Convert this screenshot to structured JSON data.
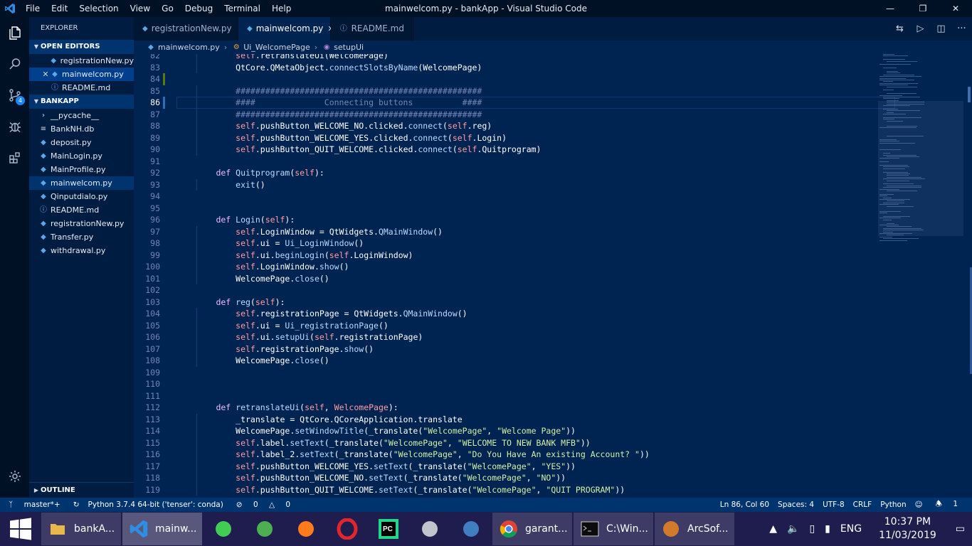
{
  "window": {
    "title": "mainwelcom.py - bankApp - Visual Studio Code",
    "menu": [
      "File",
      "Edit",
      "Selection",
      "View",
      "Go",
      "Debug",
      "Terminal",
      "Help"
    ],
    "controls": [
      "—",
      "❐",
      "✕"
    ]
  },
  "activity": {
    "scm_badge": "4"
  },
  "sidebar": {
    "title": "EXPLORER",
    "open_editors_title": "OPEN EDITORS",
    "open_editors": [
      {
        "name": "registrationNew.py",
        "icon": "py"
      },
      {
        "name": "mainwelcom.py",
        "icon": "py",
        "close": "✕"
      },
      {
        "name": "README.md",
        "icon": "info"
      }
    ],
    "project_title": "BANKAPP",
    "files": [
      {
        "name": "__pycache__",
        "icon": "folder"
      },
      {
        "name": "BankNH.db",
        "icon": "db"
      },
      {
        "name": "deposit.py",
        "icon": "py"
      },
      {
        "name": "MainLogin.py",
        "icon": "py"
      },
      {
        "name": "MainProfile.py",
        "icon": "py"
      },
      {
        "name": "mainwelcom.py",
        "icon": "py"
      },
      {
        "name": "Qinputdialo.py",
        "icon": "py"
      },
      {
        "name": "README.md",
        "icon": "info"
      },
      {
        "name": "registrationNew.py",
        "icon": "py"
      },
      {
        "name": "Transfer.py",
        "icon": "py"
      },
      {
        "name": "withdrawal.py",
        "icon": "py"
      }
    ],
    "outline_title": "OUTLINE"
  },
  "tabs": [
    {
      "label": "registrationNew.py",
      "icon": "py"
    },
    {
      "label": "mainwelcom.py",
      "icon": "py",
      "close": "✕"
    },
    {
      "label": "README.md",
      "icon": "info"
    }
  ],
  "breadcrumb": [
    "mainwelcom.py",
    "Ui_WelcomePage",
    "setupUi"
  ],
  "editor": {
    "current_line": "86",
    "lines": [
      {
        "n": "82",
        "indent": 2,
        "t": [
          [
            "self",
            "self"
          ],
          [
            "plain",
            ".retranslateUi(WelcomePage)"
          ]
        ]
      },
      {
        "n": "83",
        "indent": 2,
        "t": [
          [
            "plain",
            "QtCore.QMetaObject."
          ],
          [
            "fn",
            "connectSlotsByName"
          ],
          [
            "plain",
            "(WelcomePage)"
          ]
        ]
      },
      {
        "n": "84",
        "indent": 1,
        "t": []
      },
      {
        "n": "85",
        "indent": 2,
        "t": [
          [
            "cm",
            "##################################################"
          ]
        ]
      },
      {
        "n": "86",
        "indent": 2,
        "t": [
          [
            "cm",
            "####              Connecting buttons          ####"
          ]
        ]
      },
      {
        "n": "87",
        "indent": 2,
        "t": [
          [
            "cm",
            "##################################################"
          ]
        ]
      },
      {
        "n": "88",
        "indent": 2,
        "t": [
          [
            "self",
            "self"
          ],
          [
            "plain",
            ".pushButton_WELCOME_NO.clicked."
          ],
          [
            "fn",
            "connect"
          ],
          [
            "plain",
            "("
          ],
          [
            "self",
            "self"
          ],
          [
            "plain",
            ".reg)"
          ]
        ]
      },
      {
        "n": "89",
        "indent": 2,
        "t": [
          [
            "self",
            "self"
          ],
          [
            "plain",
            ".pushButton_WELCOME_YES.clicked."
          ],
          [
            "fn",
            "connect"
          ],
          [
            "plain",
            "("
          ],
          [
            "self",
            "self"
          ],
          [
            "plain",
            ".Login)"
          ]
        ]
      },
      {
        "n": "90",
        "indent": 2,
        "t": [
          [
            "self",
            "self"
          ],
          [
            "plain",
            ".pushButton_QUIT_WELCOME.clicked."
          ],
          [
            "fn",
            "connect"
          ],
          [
            "plain",
            "("
          ],
          [
            "self",
            "self"
          ],
          [
            "plain",
            ".Quitprogram)"
          ]
        ]
      },
      {
        "n": "91",
        "indent": 1,
        "t": []
      },
      {
        "n": "92",
        "indent": 1,
        "t": [
          [
            "kw",
            "def "
          ],
          [
            "fn",
            "Quitprogram"
          ],
          [
            "plain",
            "("
          ],
          [
            "self",
            "self"
          ],
          [
            "plain",
            "):"
          ]
        ]
      },
      {
        "n": "93",
        "indent": 2,
        "t": [
          [
            "fn",
            "exit"
          ],
          [
            "plain",
            "()"
          ]
        ]
      },
      {
        "n": "94",
        "indent": 1,
        "t": []
      },
      {
        "n": "95",
        "indent": 1,
        "t": []
      },
      {
        "n": "96",
        "indent": 1,
        "t": [
          [
            "kw",
            "def "
          ],
          [
            "fn",
            "Login"
          ],
          [
            "plain",
            "("
          ],
          [
            "self",
            "self"
          ],
          [
            "plain",
            "):"
          ]
        ]
      },
      {
        "n": "97",
        "indent": 2,
        "t": [
          [
            "self",
            "self"
          ],
          [
            "plain",
            ".LoginWindow = QtWidgets."
          ],
          [
            "fn",
            "QMainWindow"
          ],
          [
            "plain",
            "()"
          ]
        ]
      },
      {
        "n": "98",
        "indent": 2,
        "t": [
          [
            "self",
            "self"
          ],
          [
            "plain",
            ".ui = "
          ],
          [
            "fn",
            "Ui_LoginWindow"
          ],
          [
            "plain",
            "()"
          ]
        ]
      },
      {
        "n": "99",
        "indent": 2,
        "t": [
          [
            "self",
            "self"
          ],
          [
            "plain",
            ".ui."
          ],
          [
            "fn",
            "beginLogin"
          ],
          [
            "plain",
            "("
          ],
          [
            "self",
            "self"
          ],
          [
            "plain",
            ".LoginWindow)"
          ]
        ]
      },
      {
        "n": "100",
        "indent": 2,
        "t": [
          [
            "self",
            "self"
          ],
          [
            "plain",
            ".LoginWindow."
          ],
          [
            "fn",
            "show"
          ],
          [
            "plain",
            "()"
          ]
        ]
      },
      {
        "n": "101",
        "indent": 2,
        "t": [
          [
            "plain",
            "WelcomePage."
          ],
          [
            "fn",
            "close"
          ],
          [
            "plain",
            "()"
          ]
        ]
      },
      {
        "n": "102",
        "indent": 1,
        "t": []
      },
      {
        "n": "103",
        "indent": 1,
        "t": [
          [
            "kw",
            "def "
          ],
          [
            "fn",
            "reg"
          ],
          [
            "plain",
            "("
          ],
          [
            "self",
            "self"
          ],
          [
            "plain",
            "):"
          ]
        ]
      },
      {
        "n": "104",
        "indent": 2,
        "t": [
          [
            "self",
            "self"
          ],
          [
            "plain",
            ".registrationPage = QtWidgets."
          ],
          [
            "fn",
            "QMainWindow"
          ],
          [
            "plain",
            "()"
          ]
        ]
      },
      {
        "n": "105",
        "indent": 2,
        "t": [
          [
            "self",
            "self"
          ],
          [
            "plain",
            ".ui = "
          ],
          [
            "fn",
            "Ui_registrationPage"
          ],
          [
            "plain",
            "()"
          ]
        ]
      },
      {
        "n": "106",
        "indent": 2,
        "t": [
          [
            "self",
            "self"
          ],
          [
            "plain",
            ".ui."
          ],
          [
            "fn",
            "setupUi"
          ],
          [
            "plain",
            "("
          ],
          [
            "self",
            "self"
          ],
          [
            "plain",
            ".registrationPage)"
          ]
        ]
      },
      {
        "n": "107",
        "indent": 2,
        "t": [
          [
            "self",
            "self"
          ],
          [
            "plain",
            ".registrationPage."
          ],
          [
            "fn",
            "show"
          ],
          [
            "plain",
            "()"
          ]
        ]
      },
      {
        "n": "108",
        "indent": 2,
        "t": [
          [
            "plain",
            "WelcomePage."
          ],
          [
            "fn",
            "close"
          ],
          [
            "plain",
            "()"
          ]
        ]
      },
      {
        "n": "109",
        "indent": 1,
        "t": []
      },
      {
        "n": "110",
        "indent": 1,
        "t": []
      },
      {
        "n": "111",
        "indent": 1,
        "t": []
      },
      {
        "n": "112",
        "indent": 1,
        "t": [
          [
            "kw",
            "def "
          ],
          [
            "fn",
            "retranslateUi"
          ],
          [
            "plain",
            "("
          ],
          [
            "self",
            "self"
          ],
          [
            "plain",
            ", "
          ],
          [
            "self",
            "WelcomePage"
          ],
          [
            "plain",
            "):"
          ]
        ]
      },
      {
        "n": "113",
        "indent": 2,
        "t": [
          [
            "plain",
            "_translate = QtCore.QCoreApplication.translate"
          ]
        ]
      },
      {
        "n": "114",
        "indent": 2,
        "t": [
          [
            "plain",
            "WelcomePage."
          ],
          [
            "fn",
            "setWindowTitle"
          ],
          [
            "plain",
            "(_translate("
          ],
          [
            "str",
            "\"WelcomePage\""
          ],
          [
            "plain",
            ", "
          ],
          [
            "str",
            "\"Welcome Page\""
          ],
          [
            "plain",
            "))"
          ]
        ]
      },
      {
        "n": "115",
        "indent": 2,
        "t": [
          [
            "self",
            "self"
          ],
          [
            "plain",
            ".label."
          ],
          [
            "fn",
            "setText"
          ],
          [
            "plain",
            "(_translate("
          ],
          [
            "str",
            "\"WelcomePage\""
          ],
          [
            "plain",
            ", "
          ],
          [
            "str",
            "\"WELCOME TO NEW BANK MFB\""
          ],
          [
            "plain",
            "))"
          ]
        ]
      },
      {
        "n": "116",
        "indent": 2,
        "t": [
          [
            "self",
            "self"
          ],
          [
            "plain",
            ".label_2."
          ],
          [
            "fn",
            "setText"
          ],
          [
            "plain",
            "(_translate("
          ],
          [
            "str",
            "\"WelcomePage\""
          ],
          [
            "plain",
            ", "
          ],
          [
            "str",
            "\"Do You Have An existing Account? \""
          ],
          [
            "plain",
            "))"
          ]
        ]
      },
      {
        "n": "117",
        "indent": 2,
        "t": [
          [
            "self",
            "self"
          ],
          [
            "plain",
            ".pushButton_WELCOME_YES."
          ],
          [
            "fn",
            "setText"
          ],
          [
            "plain",
            "(_translate("
          ],
          [
            "str",
            "\"WelcomePage\""
          ],
          [
            "plain",
            ", "
          ],
          [
            "str",
            "\"YES\""
          ],
          [
            "plain",
            "))"
          ]
        ]
      },
      {
        "n": "118",
        "indent": 2,
        "t": [
          [
            "self",
            "self"
          ],
          [
            "plain",
            ".pushButton_WELCOME_NO."
          ],
          [
            "fn",
            "setText"
          ],
          [
            "plain",
            "(_translate("
          ],
          [
            "str",
            "\"WelcomePage\""
          ],
          [
            "plain",
            ", "
          ],
          [
            "str",
            "\"NO\""
          ],
          [
            "plain",
            "))"
          ]
        ]
      },
      {
        "n": "119",
        "indent": 2,
        "t": [
          [
            "self",
            "self"
          ],
          [
            "plain",
            ".pushButton_QUIT_WELCOME."
          ],
          [
            "fn",
            "setText"
          ],
          [
            "plain",
            "(_translate("
          ],
          [
            "str",
            "\"WelcomePage\""
          ],
          [
            "plain",
            ", "
          ],
          [
            "str",
            "\"QUIT PROGRAM\""
          ],
          [
            "plain",
            "))"
          ]
        ]
      }
    ]
  },
  "statusbar": {
    "branch": "master*+",
    "interpreter": "Python 3.7.4 64-bit ('tenser': conda)",
    "errors": "0",
    "warnings": "0",
    "position": "Ln 86, Col 60",
    "spaces": "Spaces: 4",
    "encoding": "UTF-8",
    "eol": "CRLF",
    "language": "Python",
    "notifications": "1"
  },
  "taskbar": {
    "apps": [
      {
        "kind": "wide",
        "label": "bankA...",
        "icon": "folder-icon",
        "color": "#e8b84a"
      },
      {
        "kind": "wide",
        "label": "mainw...",
        "icon": "vscode-icon",
        "color": "#2f8de4",
        "active": true
      },
      {
        "kind": "icon",
        "label": "",
        "icon": "qt-icon",
        "color": "#41cd52"
      },
      {
        "kind": "icon",
        "label": "",
        "icon": "greenapp-icon",
        "color": "#4caf50"
      },
      {
        "kind": "icon",
        "label": "",
        "icon": "firefox-icon",
        "color": "#ff7a1a"
      },
      {
        "kind": "icon",
        "label": "",
        "icon": "opera-icon",
        "color": "#e2262c"
      },
      {
        "kind": "icon",
        "label": "",
        "icon": "pycharm-icon",
        "color": "#21d789"
      },
      {
        "kind": "icon",
        "label": "",
        "icon": "database-icon",
        "color": "#c0c4cc"
      },
      {
        "kind": "icon",
        "label": "",
        "icon": "mysql-icon",
        "color": "#3f7fbf"
      },
      {
        "kind": "wide",
        "label": "garant...",
        "icon": "chrome-icon",
        "color": "#e0b90f"
      },
      {
        "kind": "wide",
        "label": "C:\\Win...",
        "icon": "cmd-icon",
        "color": "#111111"
      },
      {
        "kind": "wide",
        "label": "ArcSof...",
        "icon": "arcsoft-icon",
        "color": "#d07a2a"
      }
    ],
    "lang": "ENG",
    "time": "10:37 PM",
    "date": "11/03/2019"
  }
}
